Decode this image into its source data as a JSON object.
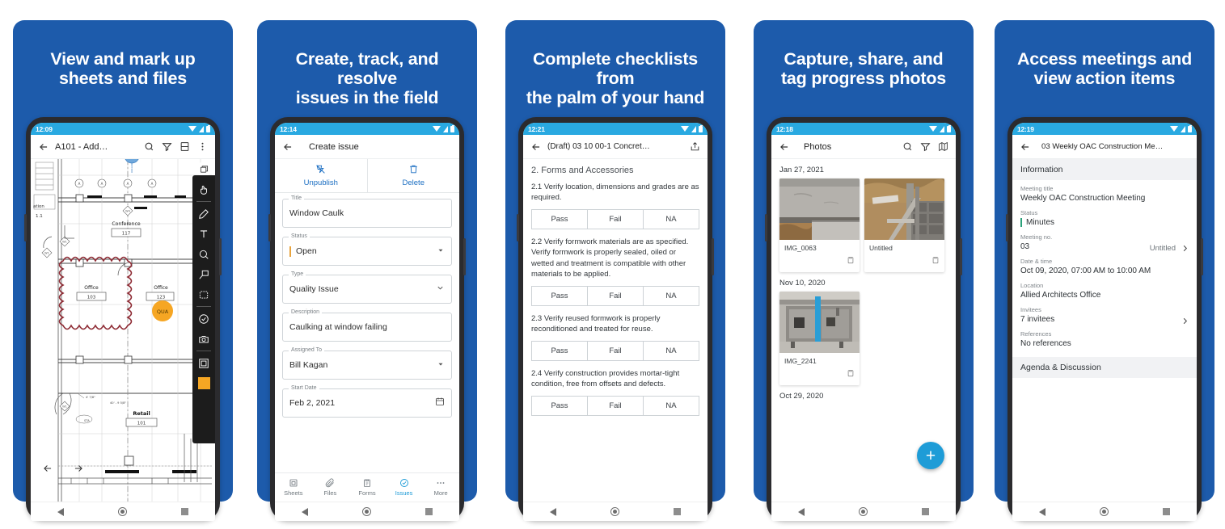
{
  "meta": {
    "brand_blue": "#1d5bab",
    "status_bar_blue": "#29a9e1",
    "accent_cyan": "#1e9cd7",
    "swatch_orange": "#f5a623"
  },
  "panels": [
    {
      "headline": "View and mark up\nsheets and files",
      "status_time": "12:09",
      "appbar": {
        "title": "A101 - Add…",
        "icons": [
          "back-arrow-icon",
          "search-icon",
          "filter-icon",
          "compare-icon",
          "overflow-menu-icon"
        ]
      },
      "plan": {
        "labels": [
          "ation",
          "1.1",
          "Conference",
          "117",
          "Office",
          "103",
          "Office",
          "123",
          "Retail",
          "101",
          "QUA",
          "A01"
        ],
        "dimension_left": "4' 7\"",
        "dimension_center": "40' - 9 5/8\"",
        "door_tag": "STA"
      },
      "toolbar": [
        "select-hand-tool",
        "pen-tool",
        "text-tool",
        "stamp-tool",
        "callout-tool",
        "cloud-tool",
        "check-tool",
        "camera-tool",
        "shape-tool",
        "color-swatch"
      ],
      "page_nav": [
        "previous-page",
        "next-page"
      ]
    },
    {
      "headline": "Create, track, and resolve\nissues in the field",
      "status_time": "12:14",
      "appbar": {
        "title": "Create issue"
      },
      "actions": [
        {
          "label": "Unpublish",
          "icon": "unpublish-icon"
        },
        {
          "label": "Delete",
          "icon": "trash-icon"
        }
      ],
      "fields": [
        {
          "label": "Title",
          "value": "Window Caulk",
          "type": "text"
        },
        {
          "label": "Status",
          "value": "Open",
          "type": "select",
          "accent": "#e8a33d"
        },
        {
          "label": "Type",
          "value": "Quality Issue",
          "type": "select"
        },
        {
          "label": "Description",
          "value": "Caulking at window failing",
          "type": "text"
        },
        {
          "label": "Assigned To",
          "value": "Bill Kagan",
          "type": "select"
        },
        {
          "label": "Start Date",
          "value": "Feb 2, 2021",
          "type": "date"
        }
      ],
      "bottom_tabs": [
        {
          "label": "Sheets",
          "icon": "sheets-icon",
          "active": false
        },
        {
          "label": "Files",
          "icon": "paperclip-icon",
          "active": false
        },
        {
          "label": "Forms",
          "icon": "clipboard-icon",
          "active": false
        },
        {
          "label": "Issues",
          "icon": "issue-check-icon",
          "active": true
        },
        {
          "label": "More",
          "icon": "more-dots-icon",
          "active": false
        }
      ]
    },
    {
      "headline": "Complete checklists from\nthe palm of your hand",
      "status_time": "12:21",
      "appbar": {
        "title": "(Draft) 03 10 00-1 Concret…",
        "icons": [
          "back-arrow-icon",
          "share-icon"
        ]
      },
      "section_title": "2. Forms and Accessories",
      "answer_options": [
        "Pass",
        "Fail",
        "NA"
      ],
      "questions": [
        "2.1 Verify location, dimensions and grades are as required.",
        "2.2 Verify formwork materials are as specified. Verify formwork is properly sealed, oiled or wetted and treatment is compatible with other materials to be applied.",
        "2.3 Verify reused formwork is properly reconditioned and treated for reuse.",
        "2.4 Verify construction provides mortar-tight condition, free from offsets and defects."
      ]
    },
    {
      "headline": "Capture, share, and\ntag progress photos",
      "status_time": "12:18",
      "appbar": {
        "title": "Photos",
        "icons": [
          "back-arrow-icon",
          "search-icon",
          "filter-icon",
          "map-icon"
        ]
      },
      "groups": [
        {
          "date": "Jan 27, 2021",
          "photos": [
            {
              "caption": "IMG_0063",
              "kind": "concrete-slab"
            },
            {
              "caption": "Untitled",
              "kind": "foundation-formwork"
            }
          ]
        },
        {
          "date": "Nov 10, 2020",
          "photos": [
            {
              "caption": "IMG_2241",
              "kind": "mechanical-room"
            }
          ]
        },
        {
          "date": "Oct 29, 2020",
          "photos": []
        }
      ],
      "fab_label": "+"
    },
    {
      "headline": "Access meetings and\nview action items",
      "status_time": "12:19",
      "appbar": {
        "title": "03 Weekly OAC Construction Me…"
      },
      "section_information": "Information",
      "rows": [
        {
          "label": "Meeting title",
          "value": "Weekly OAC Construction Meeting"
        },
        {
          "label": "Status",
          "value": "Minutes",
          "accent": "#2aa17a"
        },
        {
          "label": "Meeting no.",
          "value": "03",
          "secondary": "Untitled",
          "chevron": true
        },
        {
          "label": "Date & time",
          "value": "Oct 09, 2020, 07:00 AM to 10:00 AM"
        },
        {
          "label": "Location",
          "value": "Allied Architects Office"
        },
        {
          "label": "Invitees",
          "value": "7 invitees",
          "chevron": true
        },
        {
          "label": "References",
          "value": "No references"
        }
      ],
      "section_agenda": "Agenda & Discussion"
    }
  ]
}
